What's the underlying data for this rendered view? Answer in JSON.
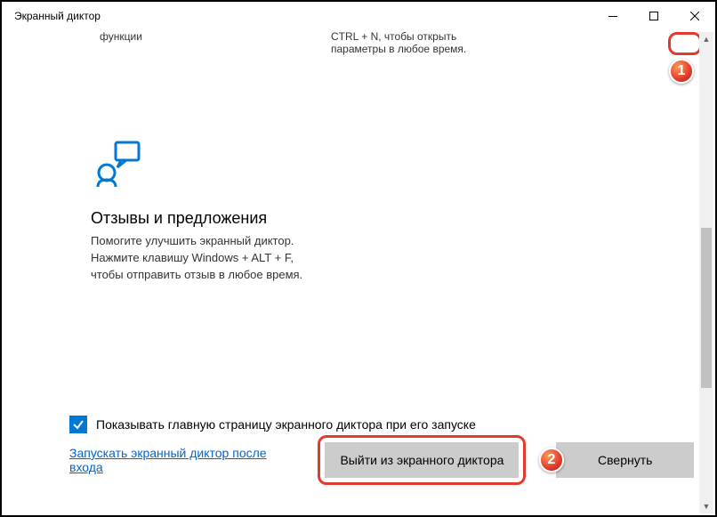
{
  "window": {
    "title": "Экранный диктор"
  },
  "top_snippets": {
    "left": "функции",
    "right": "CTRL + N, чтобы открыть параметры в любое время."
  },
  "feedback": {
    "title": "Отзывы и предложения",
    "description": "Помогите улучшить экранный диктор. Нажмите клавишу Windows + ALT + F, чтобы отправить отзыв в любое время."
  },
  "checkbox": {
    "label": "Показывать главную страницу экранного диктора при его запуске",
    "checked": true
  },
  "bottom": {
    "link": "Запускать экранный диктор после входа",
    "exit_button": "Выйти из экранного диктора",
    "minimize_button": "Свернуть"
  },
  "badges": {
    "one": "1",
    "two": "2"
  }
}
